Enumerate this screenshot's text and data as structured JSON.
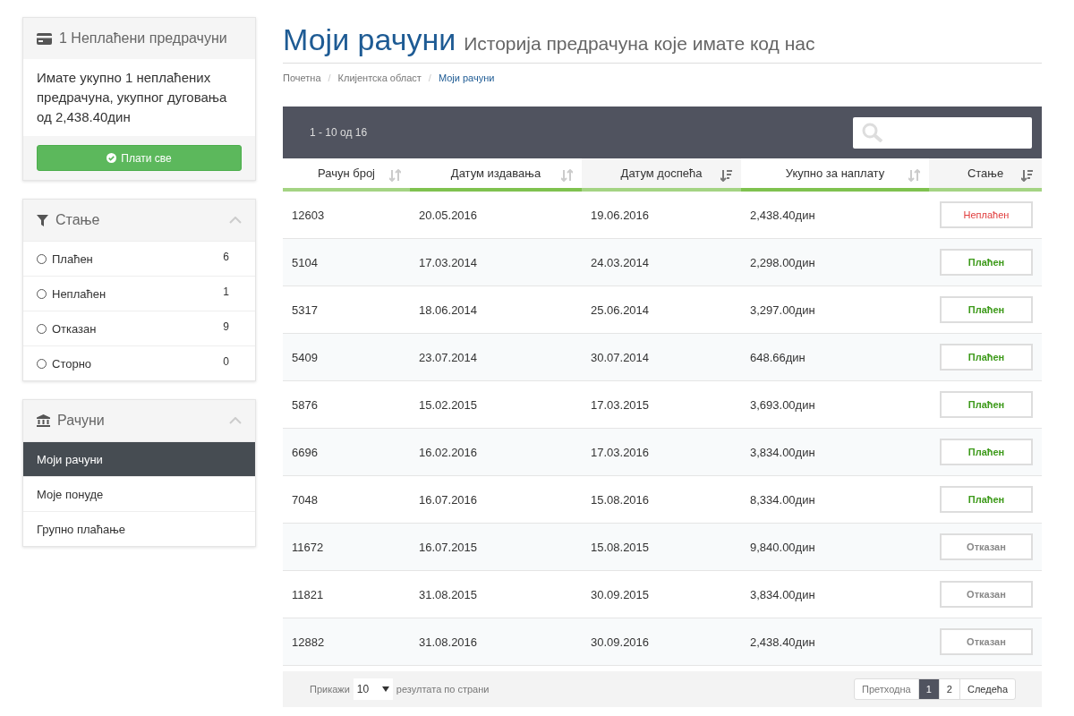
{
  "sidebar": {
    "unpaid_panel": {
      "title": "1 Неплаћени предрачуни",
      "text": "Имате укупно 1 неплаћених предрачуна, укупног дуговања од 2,438.40дин",
      "button": "Плати све"
    },
    "status_panel": {
      "title": "Стање",
      "items": [
        {
          "label": "Плаћен",
          "count": "6",
          "selected": false
        },
        {
          "label": "Неплаћен",
          "count": "1",
          "selected": false
        },
        {
          "label": "Отказан",
          "count": "9",
          "selected": false
        },
        {
          "label": "Сторно",
          "count": "0",
          "selected": false
        }
      ]
    },
    "invoices_panel": {
      "title": "Рачуни",
      "items": [
        {
          "label": "Моји рачуни",
          "selected": true
        },
        {
          "label": "Моје понуде",
          "selected": false
        },
        {
          "label": "Групно плаћање",
          "selected": false
        }
      ]
    }
  },
  "header": {
    "title": "Моји рачуни",
    "subtitle": "Историја предрачуна које имате код нас"
  },
  "breadcrumb_separator": "/",
  "breadcrumb": [
    {
      "label": "Почетна",
      "selected": false
    },
    {
      "label": "Клијентска област",
      "selected": false
    },
    {
      "label": "Моји рачуни",
      "selected": true
    }
  ],
  "table": {
    "range": "1 - 10 од 16",
    "columns": [
      {
        "label": "Рачун број",
        "sorted": false
      },
      {
        "label": "Датум издавања",
        "sorted": false
      },
      {
        "label": "Датум доспећа",
        "sorted": true
      },
      {
        "label": "Укупно за наплату",
        "sorted": false
      },
      {
        "label": "Стање",
        "sorted": true
      }
    ],
    "rows": [
      {
        "number": "12603",
        "issued": "20.05.2016",
        "due": "19.06.2016",
        "total": "2,438.40дин",
        "status": "Неплаћен",
        "kind": "unpaid"
      },
      {
        "number": "5104",
        "issued": "17.03.2014",
        "due": "24.03.2014",
        "total": "2,298.00дин",
        "status": "Плаћен",
        "kind": "paid"
      },
      {
        "number": "5317",
        "issued": "18.06.2014",
        "due": "25.06.2014",
        "total": "3,297.00дин",
        "status": "Плаћен",
        "kind": "paid"
      },
      {
        "number": "5409",
        "issued": "23.07.2014",
        "due": "30.07.2014",
        "total": "648.66дин",
        "status": "Плаћен",
        "kind": "paid"
      },
      {
        "number": "5876",
        "issued": "15.02.2015",
        "due": "17.03.2015",
        "total": "3,693.00дин",
        "status": "Плаћен",
        "kind": "paid"
      },
      {
        "number": "6696",
        "issued": "16.02.2016",
        "due": "17.03.2016",
        "total": "3,834.00дин",
        "status": "Плаћен",
        "kind": "paid"
      },
      {
        "number": "7048",
        "issued": "16.07.2016",
        "due": "15.08.2016",
        "total": "8,334.00дин",
        "status": "Плаћен",
        "kind": "paid"
      },
      {
        "number": "11672",
        "issued": "16.07.2015",
        "due": "15.08.2015",
        "total": "9,840.00дин",
        "status": "Отказан",
        "kind": "cancelled"
      },
      {
        "number": "11821",
        "issued": "31.08.2015",
        "due": "30.09.2015",
        "total": "3,834.00дин",
        "status": "Отказан",
        "kind": "cancelled"
      },
      {
        "number": "12882",
        "issued": "31.08.2016",
        "due": "30.09.2016",
        "total": "2,438.40дин",
        "status": "Отказан",
        "kind": "cancelled"
      }
    ]
  },
  "footer": {
    "show_label": "Прикажи",
    "page_size": "10",
    "per_page_label": "резултата по страни",
    "pagination": [
      {
        "label": "Претходна",
        "selected": false
      },
      {
        "label": "1",
        "selected": true
      },
      {
        "label": "2",
        "selected": false
      },
      {
        "label": "Следећа",
        "selected": false
      }
    ]
  }
}
